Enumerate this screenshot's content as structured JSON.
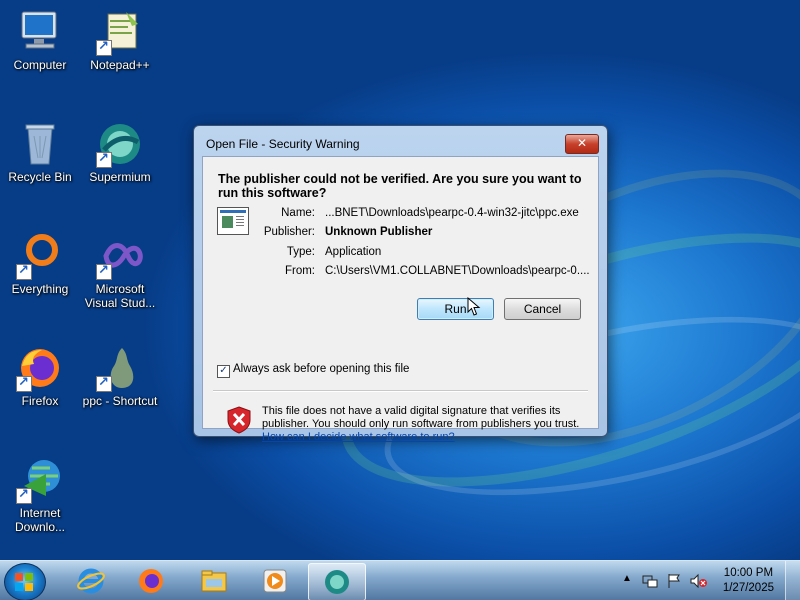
{
  "desktop": {
    "icons": [
      {
        "label": "Computer",
        "icon": "computer-icon"
      },
      {
        "label": "Notepad++",
        "icon": "notepadpp-icon"
      },
      {
        "label": "Recycle Bin",
        "icon": "recycle-bin-icon"
      },
      {
        "label": "Supermium",
        "icon": "supermium-icon"
      },
      {
        "label": "Everything",
        "icon": "everything-icon"
      },
      {
        "label": "Microsoft Visual Stud...",
        "icon": "visual-studio-icon"
      },
      {
        "label": "Firefox",
        "icon": "firefox-icon"
      },
      {
        "label": "ppc - Shortcut",
        "icon": "pear-icon"
      },
      {
        "label": "Internet Downlo...",
        "icon": "internet-download-manager-icon"
      }
    ]
  },
  "dialog": {
    "title": "Open File - Security Warning",
    "close_glyph": "✕",
    "question": "The publisher could not be verified.  Are you sure you want to run this software?",
    "fields": [
      {
        "key": "Name:",
        "value": "...BNET\\Downloads\\pearpc-0.4-win32-jitc\\ppc.exe"
      },
      {
        "key": "Publisher:",
        "value": "Unknown Publisher"
      },
      {
        "key": "Type:",
        "value": "Application"
      },
      {
        "key": "From:",
        "value": "C:\\Users\\VM1.COLLABNET\\Downloads\\pearpc-0...."
      }
    ],
    "run_label": "Run",
    "cancel_label": "Cancel",
    "checkbox_checked": true,
    "checkbox_label": "Always ask before opening this file",
    "warning_text": "This file does not have a valid digital signature that verifies its publisher.  You should only run software from publishers you trust.",
    "help_link": "How can I decide what software to run?"
  },
  "taskbar": {
    "pinned": [
      {
        "icon": "internet-explorer-icon",
        "active": false
      },
      {
        "icon": "firefox-icon",
        "active": false
      },
      {
        "icon": "file-explorer-icon",
        "active": false
      },
      {
        "icon": "media-player-icon",
        "active": false
      },
      {
        "icon": "supermium-icon",
        "active": true
      }
    ],
    "clock_time": "10:00 PM",
    "clock_date": "1/27/2025"
  },
  "colors": {
    "accent": "#1d78d0",
    "link": "#0645ad",
    "close_button": "#c7402b"
  }
}
